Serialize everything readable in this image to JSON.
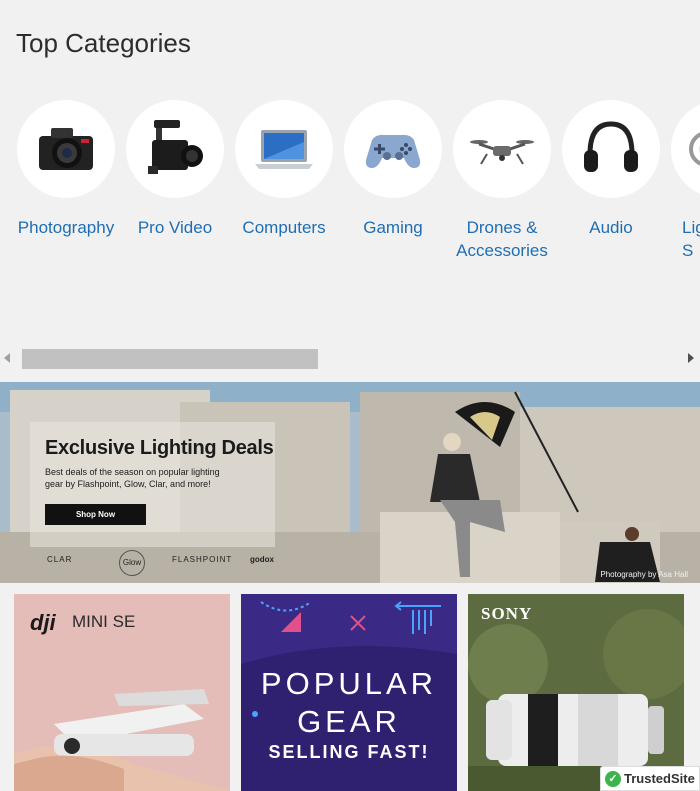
{
  "section": {
    "title": "Top Categories"
  },
  "categories": [
    {
      "label": "Photography",
      "icon": "camera-icon"
    },
    {
      "label": "Pro Video",
      "icon": "video-camera-icon"
    },
    {
      "label": "Computers",
      "icon": "laptop-icon"
    },
    {
      "label": "Gaming",
      "icon": "gamepad-icon"
    },
    {
      "label": "Drones &\nAccessories",
      "icon": "drone-icon"
    },
    {
      "label": "Audio",
      "icon": "headphones-icon"
    },
    {
      "label": "Lig\nS",
      "icon": "lighting-icon"
    }
  ],
  "banner": {
    "title": "Exclusive Lighting Deals",
    "subtitle": "Best deals of the season on popular lighting gear by Flashpoint, Glow, Clar, and more!",
    "button": "Shop Now",
    "brands": [
      "CLAR",
      "Glow",
      "FLASHPOINT",
      "godox"
    ],
    "credit": "Photography by Asa Hall"
  },
  "tiles": [
    {
      "logo": "dji",
      "product": "MINI SE"
    },
    {
      "line1": "POPULAR",
      "line2": "GEAR",
      "line3": "SELLING FAST!"
    },
    {
      "brand": "SONY"
    }
  ],
  "trusted": {
    "label": "TrustedSite",
    "check": "✓"
  },
  "colors": {
    "link": "#1f6eb3",
    "background": "#f1f1f1"
  }
}
